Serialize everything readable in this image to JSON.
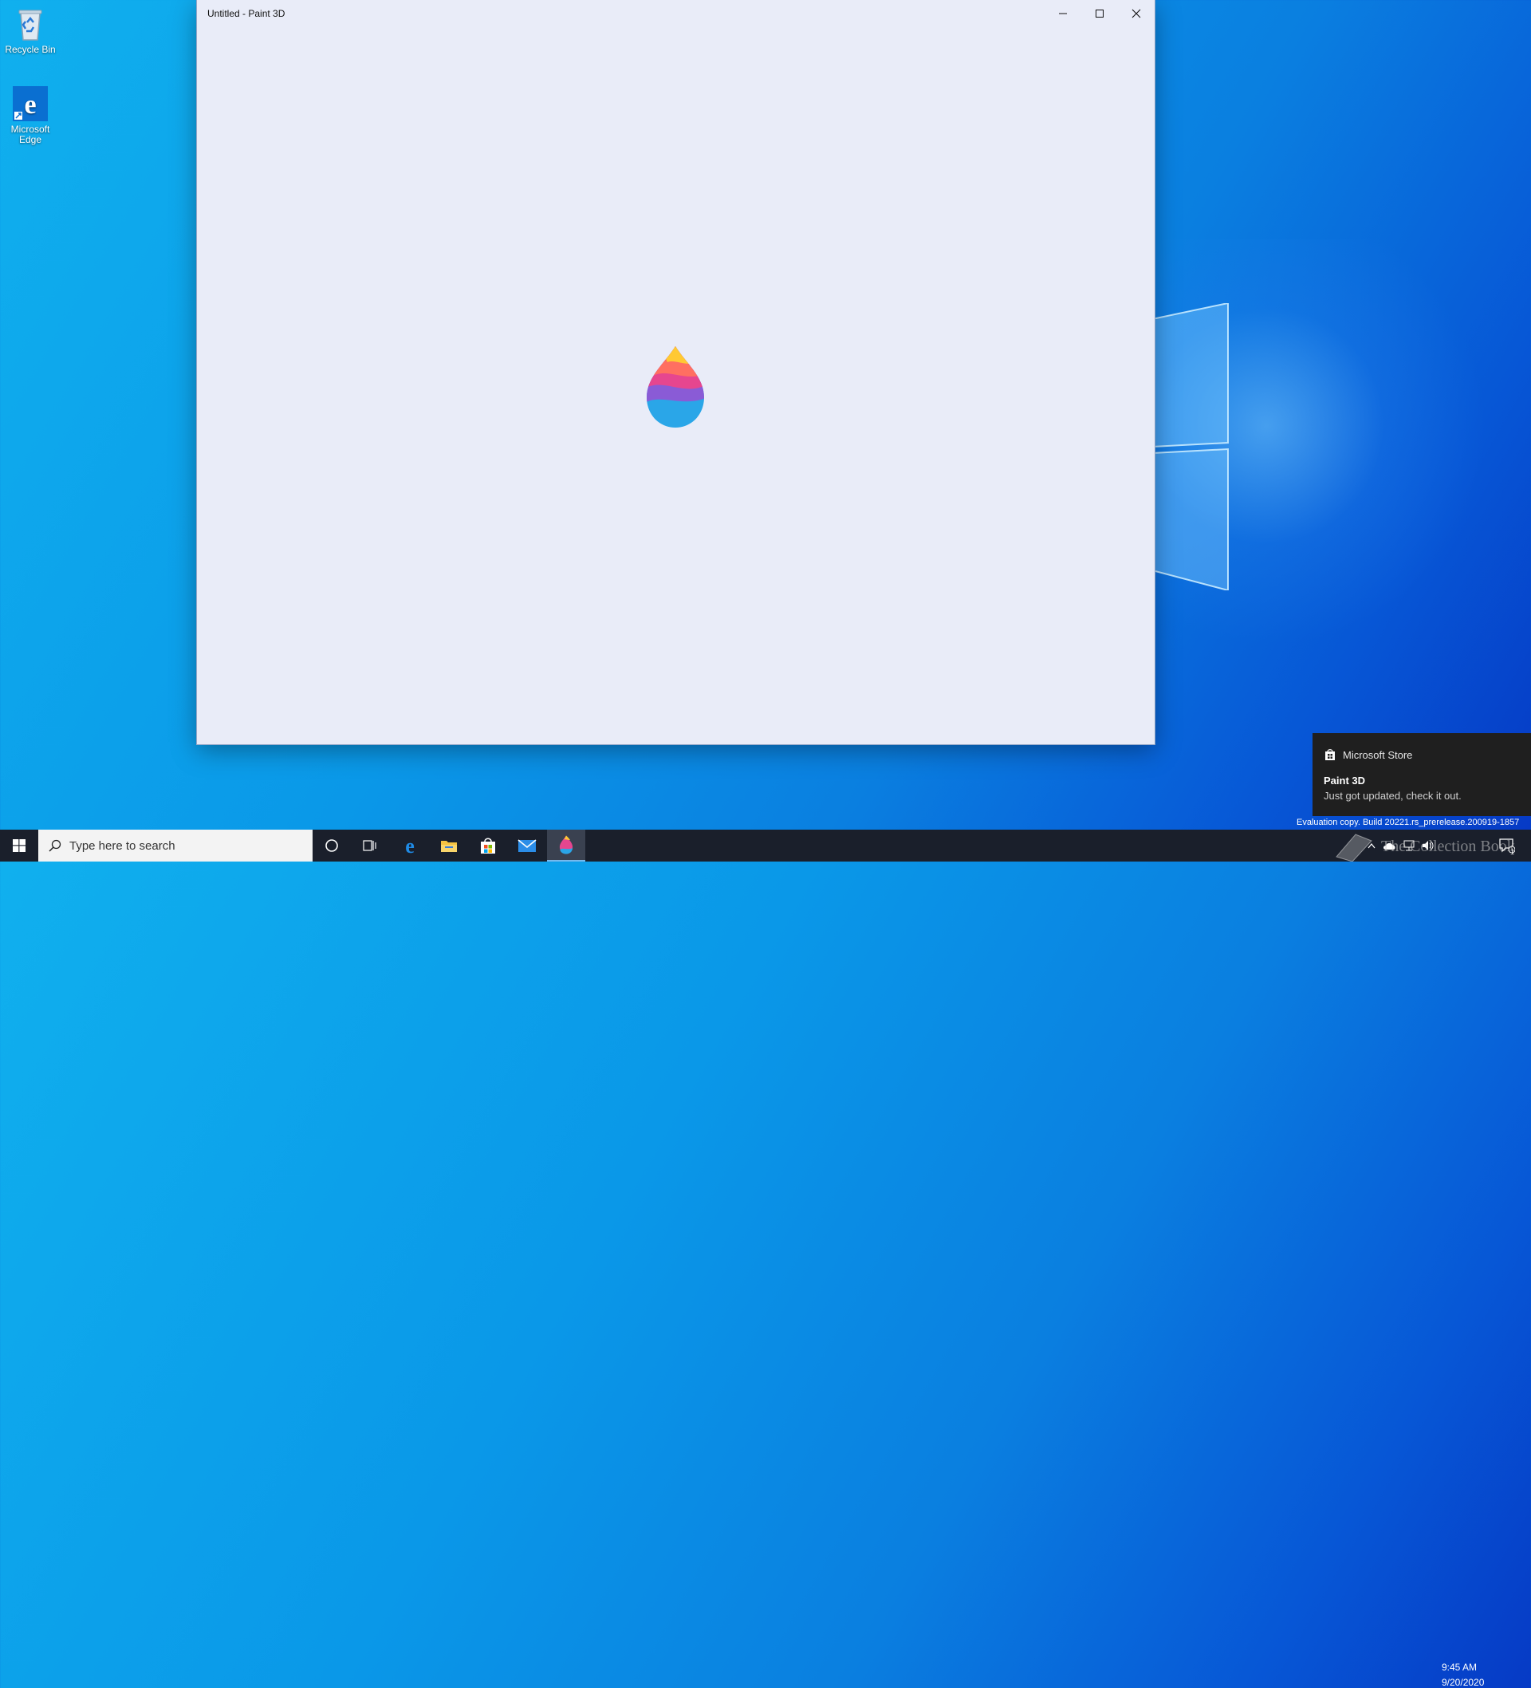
{
  "desktop": {
    "icons": [
      {
        "label": "Recycle Bin"
      },
      {
        "label": "Microsoft Edge"
      }
    ]
  },
  "window": {
    "title": "Untitled - Paint 3D",
    "state": "loading splash",
    "controls": {
      "minimize": "minimize",
      "maximize": "maximize",
      "close": "close"
    }
  },
  "notification": {
    "app": "Microsoft Store",
    "title": "Paint 3D",
    "body": "Just got updated, check it out."
  },
  "watermark": "Evaluation copy. Build 20221.rs_prerelease.200919-1857",
  "overlay_logo": "The Collection Book",
  "taskbar": {
    "search_placeholder": "Type here to search",
    "pinned": [
      "cortana-icon",
      "task-view-icon",
      "edge-icon",
      "file-explorer-icon",
      "store-icon",
      "mail-icon",
      "paint3d-icon"
    ],
    "active_app": "paint3d",
    "clock_time": "9:45 AM",
    "clock_date": "9/20/2020",
    "notification_count": "1"
  },
  "colors": {
    "taskbar": "#1a1f2b",
    "window_bg": "#e9ecf8",
    "toast_bg": "#1f1f1f",
    "accent": "#0078d7"
  }
}
